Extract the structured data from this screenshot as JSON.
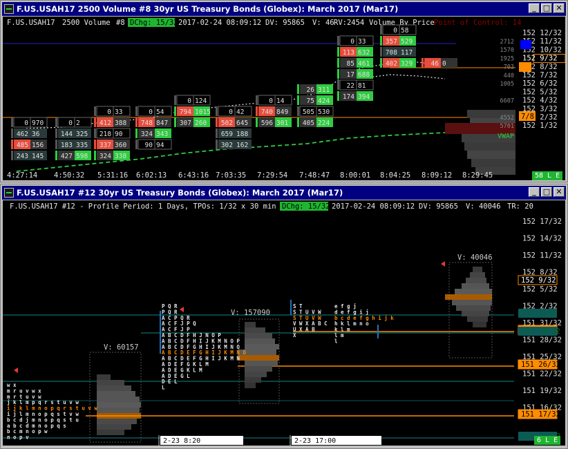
{
  "top": {
    "title": "F.US.USAH17  2500 Volume  #8  30yr US Treasury Bonds (Globex): March 2017 (Mar17)",
    "header": {
      "symbol": "F.US.USAH17",
      "period": "2500 Volume",
      "id": "#8",
      "dchg": "DChg: 15/32",
      "datetime": "2017-02-24 08:09:12",
      "dv": "DV: 95865",
      "v": "V: 46",
      "rv": "RV:2454",
      "study": "Volume By Price",
      "poc_label": "Point of Control: 14"
    },
    "price_labels": [
      "152 12/32",
      "152 11/32",
      "152 10/32",
      "152 9/32",
      "152 8/32",
      "152 7/32",
      "152 6/32",
      "152 5/32",
      "152 4/32",
      "152 3/32",
      "152 2/32",
      "152 1/32"
    ],
    "vbp_values": [
      "2712",
      "1570",
      "1925",
      "703",
      "440",
      "1005",
      "",
      "6607",
      "",
      "4552",
      "5701"
    ],
    "highlight_price": "152 9/32",
    "box_78": "7/8",
    "vwap": "VWAP",
    "time_labels": [
      "4:27:14",
      "4:50:32",
      "5:31:16",
      "6:02:13",
      "6:43:16",
      "7:03:35",
      "7:29:54",
      "7:48:47",
      "8:00:01",
      "8:04:25",
      "8:09:12",
      "8:29:45"
    ],
    "status": "58 L E",
    "colors": {
      "green": "#2ecc40",
      "red": "#e74c3c",
      "orange": "#ff8c00",
      "blue": "#0000ff",
      "gray": "#555555"
    }
  },
  "bottom": {
    "title": "F.US.USAH17  #12  30yr US Treasury Bonds (Globex): March 2017 (Mar17)",
    "header": {
      "text": "F.US.USAH17  #12 - Profile Period: 1 Days, TPOs: 1/32 x 30 min",
      "dchg": "DChg: 15/32",
      "datetime": "2017-02-24 08:09:12",
      "dv": "DV: 95865",
      "v": "V: 40046",
      "tr": "TR: 20"
    },
    "price_labels": [
      "152 17/32",
      "152 14/32",
      "152 11/32",
      "152 8/32",
      "152 5/32",
      "152 2/32",
      "151 31/32",
      "151 28/32",
      "151 25/32",
      "151 22/32",
      "151 19/32",
      "151 16/32"
    ],
    "boxed_prices": [
      "152 9/32",
      "152 0/32",
      "151 26/32",
      "151 17/32"
    ],
    "teal_prices": [
      "152 3/32",
      "151 30/32",
      "151 13/32"
    ],
    "volumes": [
      "V: 60157",
      "V: 157090",
      "V: 40046"
    ],
    "date_labels": [
      "2-23  8:20",
      "2-23  17:00"
    ],
    "status": "6 L E",
    "tpo_col1": [
      "w x",
      "m r u v w x",
      "m r t u v w",
      "j k l m p q r s t u v w",
      "i j k l m n o p q r s t u v w",
      "i j l m n o p q s t v w",
      "b c d j m n o p q s t u",
      "a b c d m n o p q s",
      "b c m n o p w",
      "n o p v"
    ],
    "tpo_col2": [
      "P Q R",
      "P Q R",
      "A C P Q R",
      "A C F J P Q",
      "A C F J P",
      "A B C D F H J N O P",
      "A B C D F H I J K M N O P",
      "A B C D F G H I J K M N O",
      "A B C D E F G H I J K M N O",
      "A B C D E F G H I J K M N",
      "A D E F G K L M",
      "A D E G K L M",
      "A D E G L",
      "D E L",
      "L"
    ],
    "tpo_col3": [
      "S T",
      "S T U V W",
      "S T U V W",
      "V W X A B C",
      "U X A B",
      "X"
    ],
    "tpo_col4": [
      "e f g    j",
      "d e f g i j",
      "b c d e f g h i j k",
      "h  k l m n o",
      "k l m",
      "l m",
      "l"
    ]
  }
}
